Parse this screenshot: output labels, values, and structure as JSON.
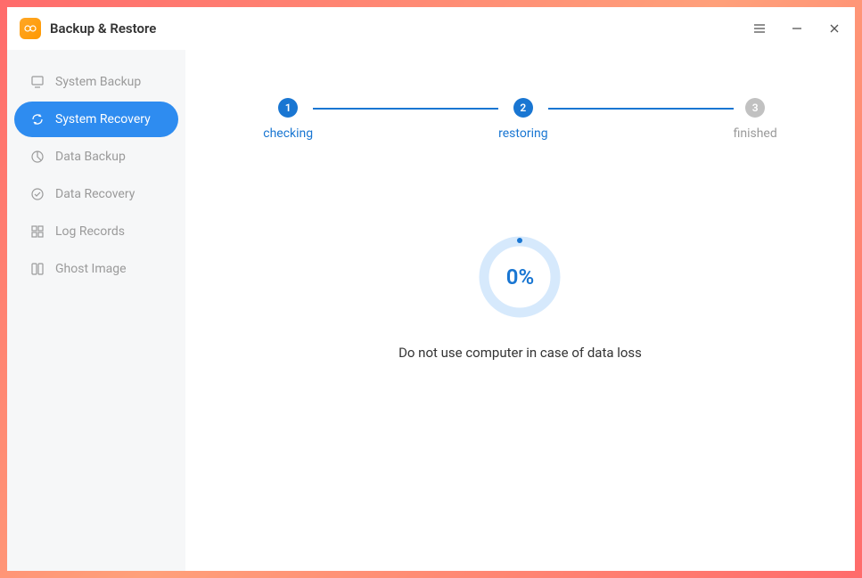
{
  "titlebar": {
    "title": "Backup & Restore"
  },
  "sidebar": {
    "items": [
      {
        "label": "System Backup",
        "icon": "monitor-icon"
      },
      {
        "label": "System Recovery",
        "icon": "refresh-icon"
      },
      {
        "label": "Data Backup",
        "icon": "pie-icon"
      },
      {
        "label": "Data Recovery",
        "icon": "restore-icon"
      },
      {
        "label": "Log Records",
        "icon": "grid-icon"
      },
      {
        "label": "Ghost Image",
        "icon": "book-icon"
      }
    ],
    "active_index": 1
  },
  "stepper": {
    "steps": [
      {
        "num": "1",
        "label": "checking",
        "state": "active"
      },
      {
        "num": "2",
        "label": "restoring",
        "state": "active"
      },
      {
        "num": "3",
        "label": "finished",
        "state": "inactive"
      }
    ]
  },
  "progress": {
    "percent_label": "0%",
    "value": 0
  },
  "warning": "Do not use computer in case of data loss"
}
